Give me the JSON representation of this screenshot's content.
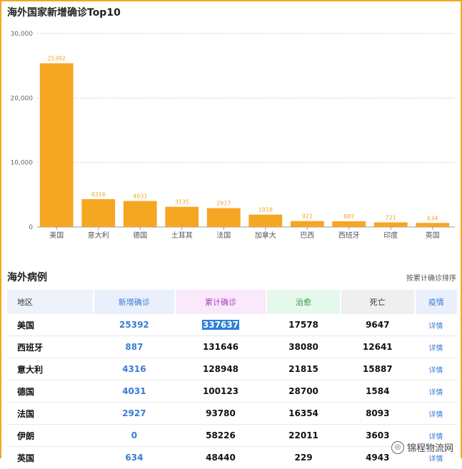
{
  "chart_data": {
    "type": "bar",
    "title": "海外国家新增确诊Top10",
    "categories": [
      "美国",
      "意大利",
      "德国",
      "土耳其",
      "法国",
      "加拿大",
      "巴西",
      "西班牙",
      "印度",
      "英国"
    ],
    "values": [
      25392,
      4316,
      4031,
      3135,
      2927,
      1918,
      921,
      887,
      721,
      634
    ],
    "ylim": [
      0,
      30000
    ],
    "yticks": [
      "0",
      "10,000",
      "20,000",
      "30,000"
    ],
    "ytick_values": [
      0,
      10000,
      20000,
      30000
    ],
    "grid": true,
    "bar_color": "#f5a623"
  },
  "section": {
    "title": "海外病例",
    "sort_label": "按累计确诊排序"
  },
  "table": {
    "headers": [
      "地区",
      "新增确诊",
      "累计确诊",
      "治愈",
      "死亡",
      "疫情"
    ],
    "rows": [
      {
        "region": "美国",
        "new": "25392",
        "total": "337637",
        "cured": "17578",
        "dead": "9647",
        "detail": "详情"
      },
      {
        "region": "西班牙",
        "new": "887",
        "total": "131646",
        "cured": "38080",
        "dead": "12641",
        "detail": "详情"
      },
      {
        "region": "意大利",
        "new": "4316",
        "total": "128948",
        "cured": "21815",
        "dead": "15887",
        "detail": "详情"
      },
      {
        "region": "德国",
        "new": "4031",
        "total": "100123",
        "cured": "28700",
        "dead": "1584",
        "detail": "详情"
      },
      {
        "region": "法国",
        "new": "2927",
        "total": "93780",
        "cured": "16354",
        "dead": "8093",
        "detail": "详情"
      },
      {
        "region": "伊朗",
        "new": "0",
        "total": "58226",
        "cured": "22011",
        "dead": "3603",
        "detail": "详情"
      },
      {
        "region": "英国",
        "new": "634",
        "total": "48440",
        "cured": "229",
        "dead": "4943",
        "detail": "详情"
      }
    ]
  },
  "watermark": "锦程物流网",
  "colors": {
    "accent": "#f5a623",
    "link": "#3a7bd5"
  }
}
